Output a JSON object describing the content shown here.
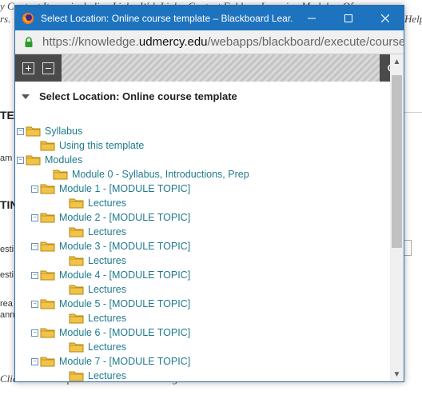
{
  "background": {
    "top_line": "y Content Items, including Links, Web Links, Content Folders, Learning Modules, Of",
    "second_line_left": "rs.",
    "second_line_right": "Help",
    "left_frags": [
      "TE",
      "am",
      "TIN",
      "esti",
      "esti",
      "rea",
      "ann"
    ],
    "bottom_line": "Click Cancel to proceed. Click Cancel to go back."
  },
  "window": {
    "title": "Select Location: Online course template – Blackboard Lear...",
    "url_prefix": "https://knowledge.",
    "url_host": "udmercy.edu",
    "url_path": "/webapps/blackboard/execute/course/cc"
  },
  "panel": {
    "heading": "Select Location: Online course template"
  },
  "tree": [
    {
      "label": "Syllabus"
    },
    {
      "label": "Using this template"
    },
    {
      "label": "Modules"
    },
    {
      "label": "Module 0 - Syllabus, Introductions, Prep"
    },
    {
      "label": "Module 1 - [MODULE TOPIC]"
    },
    {
      "label": "Lectures"
    },
    {
      "label": "Module 2 - [MODULE TOPIC]"
    },
    {
      "label": "Lectures"
    },
    {
      "label": "Module 3 - [MODULE TOPIC]"
    },
    {
      "label": "Lectures"
    },
    {
      "label": "Module 4 - [MODULE TOPIC]"
    },
    {
      "label": "Lectures"
    },
    {
      "label": "Module 5 - [MODULE TOPIC]"
    },
    {
      "label": "Lectures"
    },
    {
      "label": "Module 6 - [MODULE TOPIC]"
    },
    {
      "label": "Lectures"
    },
    {
      "label": "Module 7 - [MODULE TOPIC]"
    },
    {
      "label": "Lectures"
    }
  ],
  "colors": {
    "titlebar": "#1e73be",
    "link": "#1f7a8c",
    "folder": "#f0c44a"
  }
}
